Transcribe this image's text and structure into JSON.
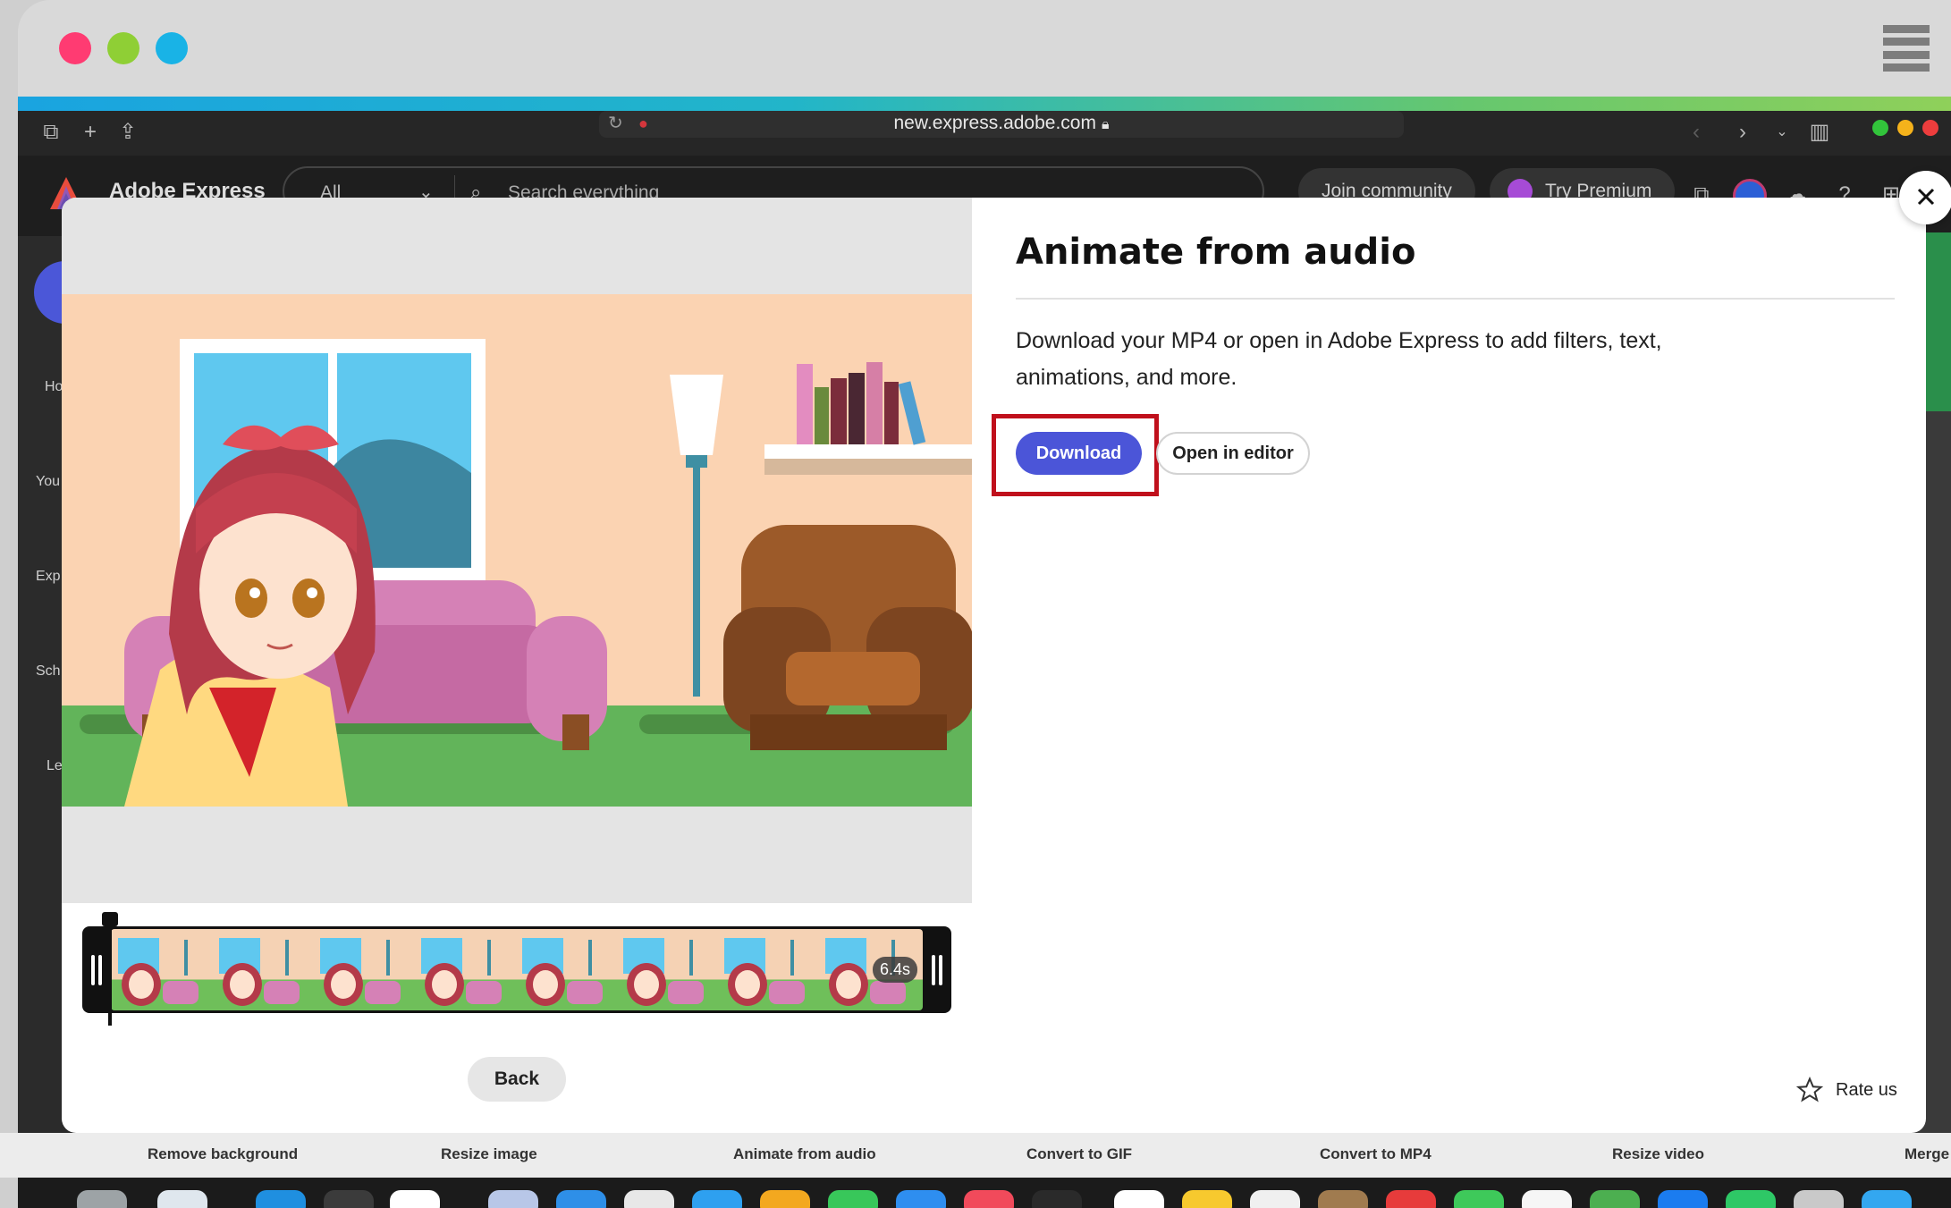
{
  "browser": {
    "url": "new.express.adobe.com"
  },
  "express": {
    "brand": "Adobe Express",
    "filter": "All",
    "search_placeholder": "Search everything",
    "join_community": "Join community",
    "try_premium": "Try Premium",
    "rail": [
      "Ho",
      "You",
      "Exp",
      "Sch",
      "Le"
    ]
  },
  "modal": {
    "title": "Animate from audio",
    "description": "Download your MP4 or open in Adobe Express to add filters, text, animations, and more.",
    "download_label": "Download",
    "open_editor_label": "Open in editor",
    "back_label": "Back",
    "rate_label": "Rate us",
    "duration": "6.4s"
  },
  "quick_tools": [
    "Remove background",
    "Resize image",
    "Animate from audio",
    "Convert to GIF",
    "Convert to MP4",
    "Resize video",
    "Merge"
  ],
  "colors": {
    "accent": "#4b55d8",
    "highlight": "#c0101c"
  }
}
